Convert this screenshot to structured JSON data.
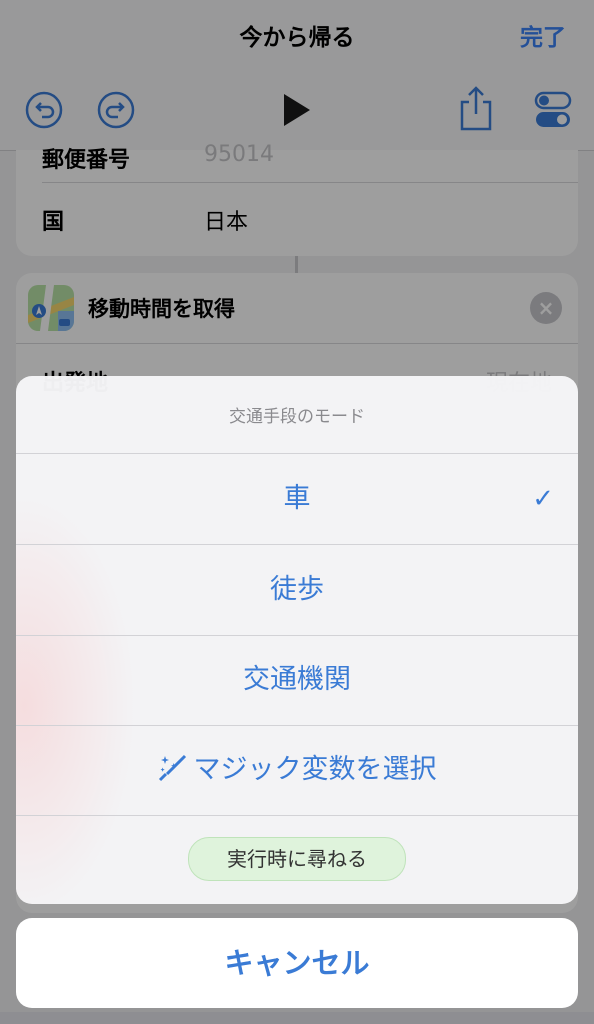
{
  "nav": {
    "title": "今から帰る",
    "done_label": "完了"
  },
  "editor": {
    "address_card": {
      "rows": [
        {
          "label": "郵便番号",
          "value": "95014"
        },
        {
          "label": "国",
          "value": "日本"
        }
      ]
    },
    "action": {
      "title": "移動時間を取得",
      "row_label": "出発地",
      "row_value": "現在地"
    }
  },
  "sheet": {
    "title": "交通手段のモード",
    "options": [
      {
        "label": "車",
        "selected": true
      },
      {
        "label": "徒歩",
        "selected": false
      },
      {
        "label": "交通機関",
        "selected": false
      },
      {
        "label": "マジック変数を選択",
        "selected": false
      }
    ],
    "ask_label": "実行時に尋ねる",
    "checkmark": "✓"
  },
  "cancel_label": "キャンセル",
  "colors": {
    "accent": "#3a7bd5",
    "ask_pill_bg": "#dff3dc"
  }
}
